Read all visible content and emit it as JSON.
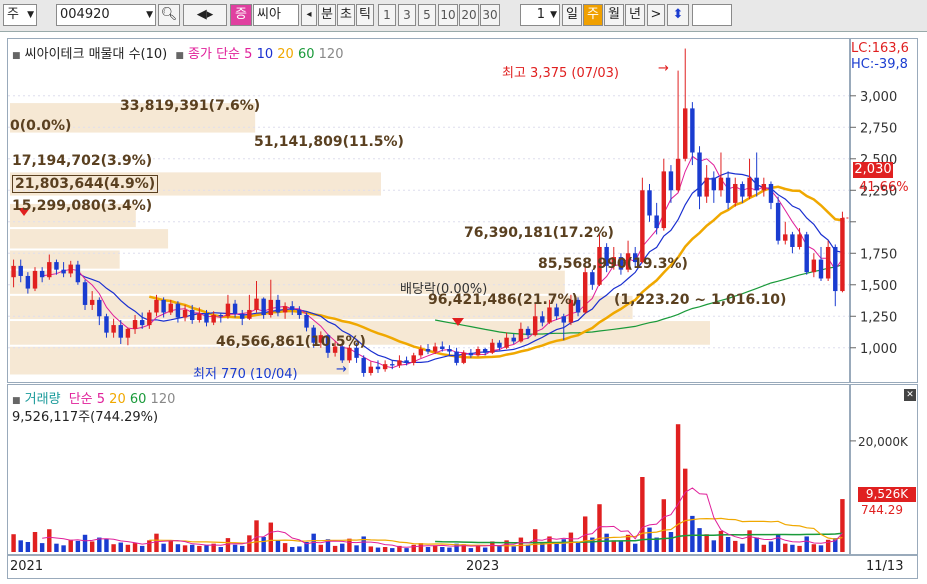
{
  "toolbar": {
    "type_select": "주",
    "code": "004920",
    "name_tag": "증",
    "name": "씨아",
    "arrow_left": "◂",
    "minute": "분",
    "second": "초",
    "tick": "틱",
    "periods": [
      "1",
      "3",
      "5",
      "10",
      "20",
      "30"
    ],
    "count": "1",
    "day": "일",
    "week": "주",
    "month": "월",
    "year": "년",
    "arrow_right": ">",
    "updown": "⬍"
  },
  "price_panel": {
    "stock_title": "씨아이테크 매물대 수(10)",
    "ma_label": "종가 단순",
    "ma_periods": [
      "5",
      "10",
      "20",
      "60",
      "120"
    ],
    "ma_colors": [
      "#e0209a",
      "#1a2fd0",
      "#f0a800",
      "#1a9a3a",
      "#888888"
    ],
    "lc": "LC:163,6",
    "hc": "HC:-39,8",
    "high_label": "최고 3,375 (07/03)",
    "low_label": "최저 770 (10/04)",
    "dividend_label": "배당락(0.00%)",
    "range_label": "(1,223.20 ~ 1,016.10)",
    "current_price": "2,030",
    "current_pct": "41.66%",
    "up_color": "#e02020",
    "down_color": "#1a3cd0"
  },
  "volume_profile": [
    {
      "price_hi": 2950,
      "price_lo": 2700,
      "label": "33,819,391(7.6%)"
    },
    {
      "price_hi": 2600,
      "price_lo": 2450,
      "label": "0(0.0%)"
    },
    {
      "price_hi": 2400,
      "price_lo": 2200,
      "label": "51,141,809(11.5%)"
    },
    {
      "price_hi": 2150,
      "price_lo": 1950,
      "label": "17,194,702(3.9%)"
    },
    {
      "price_hi": 1950,
      "price_lo": 1780,
      "label": "21,803,644(4.9%)"
    },
    {
      "price_hi": 1780,
      "price_lo": 1620,
      "label": "15,299,080(3.4%)"
    },
    {
      "price_hi": 1620,
      "price_lo": 1420,
      "label": "76,390,181(17.2%)"
    },
    {
      "price_hi": 1420,
      "price_lo": 1220,
      "label": "85,568,990(19.3%)"
    },
    {
      "price_hi": 1220,
      "price_lo": 1016,
      "label": "96,421,486(21.7%)"
    },
    {
      "price_hi": 1016,
      "price_lo": 780,
      "label": "46,566,861(10.5%)"
    }
  ],
  "volume_panel": {
    "title": "거래량",
    "ma_label": "단순",
    "ma_periods": [
      "5",
      "20",
      "60",
      "120"
    ],
    "ma_colors": [
      "#e0209a",
      "#f0a800",
      "#1a9a3a",
      "#888888"
    ],
    "current_label": "9,526,117주(744.29%)",
    "current_value": "9,526K",
    "current_pct": "744.29"
  },
  "x_axis": {
    "labels": [
      "2021",
      "2023",
      "11/13"
    ]
  },
  "chart_data": {
    "type": "candlestick",
    "y_axis_price": {
      "ticks": [
        1000,
        1250,
        1500,
        1750,
        2000,
        2250,
        2500,
        2750,
        3000
      ],
      "tick_labels": [
        "1,000",
        "1,250",
        "1,500",
        "1,750",
        "",
        "2,250",
        "2,500",
        "2,750",
        "3,000"
      ],
      "ylim": [
        760,
        3300
      ]
    },
    "y_axis_volume": {
      "ticks": [
        20000
      ],
      "tick_labels": [
        "20,000K"
      ],
      "ylim": [
        0,
        27000
      ]
    },
    "weekly": [
      {
        "o": 1560,
        "c": 1650,
        "h": 1700,
        "l": 1480,
        "v": 3200
      },
      {
        "o": 1650,
        "c": 1570,
        "h": 1700,
        "l": 1520,
        "v": 2100
      },
      {
        "o": 1570,
        "c": 1470,
        "h": 1600,
        "l": 1430,
        "v": 1800
      },
      {
        "o": 1470,
        "c": 1610,
        "h": 1640,
        "l": 1450,
        "v": 3600
      },
      {
        "o": 1610,
        "c": 1560,
        "h": 1640,
        "l": 1520,
        "v": 1600
      },
      {
        "o": 1560,
        "c": 1680,
        "h": 1740,
        "l": 1540,
        "v": 4100
      },
      {
        "o": 1680,
        "c": 1620,
        "h": 1700,
        "l": 1580,
        "v": 1500
      },
      {
        "o": 1620,
        "c": 1590,
        "h": 1680,
        "l": 1560,
        "v": 1200
      },
      {
        "o": 1590,
        "c": 1660,
        "h": 1690,
        "l": 1560,
        "v": 2200
      },
      {
        "o": 1660,
        "c": 1520,
        "h": 1690,
        "l": 1500,
        "v": 2000
      },
      {
        "o": 1520,
        "c": 1340,
        "h": 1540,
        "l": 1300,
        "v": 3100
      },
      {
        "o": 1340,
        "c": 1380,
        "h": 1450,
        "l": 1300,
        "v": 1900
      },
      {
        "o": 1380,
        "c": 1250,
        "h": 1400,
        "l": 1180,
        "v": 2600
      },
      {
        "o": 1250,
        "c": 1120,
        "h": 1270,
        "l": 1080,
        "v": 2400
      },
      {
        "o": 1120,
        "c": 1180,
        "h": 1230,
        "l": 1080,
        "v": 1400
      },
      {
        "o": 1180,
        "c": 1080,
        "h": 1220,
        "l": 1030,
        "v": 1700
      },
      {
        "o": 1080,
        "c": 1150,
        "h": 1160,
        "l": 1020,
        "v": 1300
      },
      {
        "o": 1150,
        "c": 1220,
        "h": 1260,
        "l": 1110,
        "v": 1600
      },
      {
        "o": 1220,
        "c": 1180,
        "h": 1280,
        "l": 1150,
        "v": 1100
      },
      {
        "o": 1180,
        "c": 1280,
        "h": 1300,
        "l": 1150,
        "v": 2100
      },
      {
        "o": 1280,
        "c": 1380,
        "h": 1420,
        "l": 1250,
        "v": 3300
      },
      {
        "o": 1380,
        "c": 1280,
        "h": 1400,
        "l": 1240,
        "v": 1500
      },
      {
        "o": 1280,
        "c": 1350,
        "h": 1380,
        "l": 1260,
        "v": 2000
      },
      {
        "o": 1350,
        "c": 1240,
        "h": 1370,
        "l": 1200,
        "v": 1400
      },
      {
        "o": 1240,
        "c": 1300,
        "h": 1340,
        "l": 1210,
        "v": 1200
      },
      {
        "o": 1300,
        "c": 1220,
        "h": 1340,
        "l": 1190,
        "v": 1300
      },
      {
        "o": 1220,
        "c": 1270,
        "h": 1320,
        "l": 1200,
        "v": 1100
      },
      {
        "o": 1270,
        "c": 1200,
        "h": 1300,
        "l": 1170,
        "v": 1200
      },
      {
        "o": 1200,
        "c": 1260,
        "h": 1290,
        "l": 1180,
        "v": 1500
      },
      {
        "o": 1260,
        "c": 1250,
        "h": 1280,
        "l": 1200,
        "v": 900
      },
      {
        "o": 1250,
        "c": 1350,
        "h": 1420,
        "l": 1230,
        "v": 2500
      },
      {
        "o": 1350,
        "c": 1270,
        "h": 1380,
        "l": 1240,
        "v": 1300
      },
      {
        "o": 1270,
        "c": 1230,
        "h": 1300,
        "l": 1180,
        "v": 1100
      },
      {
        "o": 1230,
        "c": 1300,
        "h": 1420,
        "l": 1220,
        "v": 3000
      },
      {
        "o": 1300,
        "c": 1390,
        "h": 1530,
        "l": 1280,
        "v": 5700
      },
      {
        "o": 1390,
        "c": 1260,
        "h": 1400,
        "l": 1230,
        "v": 2700
      },
      {
        "o": 1260,
        "c": 1380,
        "h": 1540,
        "l": 1240,
        "v": 5300
      },
      {
        "o": 1380,
        "c": 1280,
        "h": 1420,
        "l": 1250,
        "v": 2100
      },
      {
        "o": 1280,
        "c": 1330,
        "h": 1360,
        "l": 1230,
        "v": 1600
      },
      {
        "o": 1330,
        "c": 1300,
        "h": 1370,
        "l": 1260,
        "v": 900
      },
      {
        "o": 1300,
        "c": 1260,
        "h": 1330,
        "l": 1230,
        "v": 1000
      },
      {
        "o": 1260,
        "c": 1160,
        "h": 1280,
        "l": 1130,
        "v": 1800
      },
      {
        "o": 1160,
        "c": 1040,
        "h": 1180,
        "l": 1000,
        "v": 3300
      },
      {
        "o": 1040,
        "c": 1100,
        "h": 1130,
        "l": 1000,
        "v": 1300
      },
      {
        "o": 1100,
        "c": 960,
        "h": 1110,
        "l": 920,
        "v": 2300
      },
      {
        "o": 960,
        "c": 1010,
        "h": 1050,
        "l": 930,
        "v": 1100
      },
      {
        "o": 1010,
        "c": 900,
        "h": 1020,
        "l": 880,
        "v": 1500
      },
      {
        "o": 900,
        "c": 1000,
        "h": 1020,
        "l": 880,
        "v": 2400
      },
      {
        "o": 1000,
        "c": 920,
        "h": 1040,
        "l": 880,
        "v": 1200
      },
      {
        "o": 920,
        "c": 800,
        "h": 940,
        "l": 770,
        "v": 2800
      },
      {
        "o": 800,
        "c": 850,
        "h": 890,
        "l": 780,
        "v": 1000
      },
      {
        "o": 850,
        "c": 830,
        "h": 900,
        "l": 800,
        "v": 800
      },
      {
        "o": 830,
        "c": 870,
        "h": 900,
        "l": 810,
        "v": 900
      },
      {
        "o": 870,
        "c": 860,
        "h": 900,
        "l": 830,
        "v": 700
      },
      {
        "o": 860,
        "c": 900,
        "h": 940,
        "l": 840,
        "v": 1100
      },
      {
        "o": 900,
        "c": 880,
        "h": 930,
        "l": 860,
        "v": 700
      },
      {
        "o": 880,
        "c": 940,
        "h": 960,
        "l": 860,
        "v": 1300
      },
      {
        "o": 940,
        "c": 990,
        "h": 1020,
        "l": 920,
        "v": 1600
      },
      {
        "o": 990,
        "c": 970,
        "h": 1030,
        "l": 950,
        "v": 900
      },
      {
        "o": 970,
        "c": 1010,
        "h": 1040,
        "l": 950,
        "v": 1200
      },
      {
        "o": 1010,
        "c": 990,
        "h": 1050,
        "l": 970,
        "v": 900
      },
      {
        "o": 990,
        "c": 970,
        "h": 1020,
        "l": 940,
        "v": 800
      },
      {
        "o": 970,
        "c": 880,
        "h": 1000,
        "l": 860,
        "v": 1500
      },
      {
        "o": 880,
        "c": 960,
        "h": 980,
        "l": 870,
        "v": 1400
      },
      {
        "o": 960,
        "c": 940,
        "h": 990,
        "l": 920,
        "v": 700
      },
      {
        "o": 940,
        "c": 990,
        "h": 1010,
        "l": 930,
        "v": 1100
      },
      {
        "o": 990,
        "c": 960,
        "h": 1000,
        "l": 940,
        "v": 800
      },
      {
        "o": 960,
        "c": 1040,
        "h": 1070,
        "l": 950,
        "v": 1900
      },
      {
        "o": 1040,
        "c": 1000,
        "h": 1060,
        "l": 980,
        "v": 1100
      },
      {
        "o": 1000,
        "c": 1080,
        "h": 1120,
        "l": 990,
        "v": 2100
      },
      {
        "o": 1080,
        "c": 1050,
        "h": 1110,
        "l": 1030,
        "v": 1000
      },
      {
        "o": 1050,
        "c": 1150,
        "h": 1200,
        "l": 1040,
        "v": 2600
      },
      {
        "o": 1150,
        "c": 1100,
        "h": 1170,
        "l": 1070,
        "v": 1300
      },
      {
        "o": 1100,
        "c": 1250,
        "h": 1350,
        "l": 1090,
        "v": 4100
      },
      {
        "o": 1250,
        "c": 1200,
        "h": 1290,
        "l": 1170,
        "v": 1600
      },
      {
        "o": 1200,
        "c": 1320,
        "h": 1380,
        "l": 1190,
        "v": 2800
      },
      {
        "o": 1320,
        "c": 1250,
        "h": 1350,
        "l": 1220,
        "v": 1600
      },
      {
        "o": 1250,
        "c": 1200,
        "h": 1270,
        "l": 1060,
        "v": 2300
      },
      {
        "o": 1200,
        "c": 1380,
        "h": 1420,
        "l": 1180,
        "v": 3500
      },
      {
        "o": 1380,
        "c": 1280,
        "h": 1400,
        "l": 1250,
        "v": 1800
      },
      {
        "o": 1280,
        "c": 1600,
        "h": 1650,
        "l": 1270,
        "v": 6400
      },
      {
        "o": 1600,
        "c": 1500,
        "h": 1620,
        "l": 1460,
        "v": 2600
      },
      {
        "o": 1500,
        "c": 1800,
        "h": 1900,
        "l": 1490,
        "v": 8600
      },
      {
        "o": 1800,
        "c": 1650,
        "h": 1830,
        "l": 1600,
        "v": 3300
      },
      {
        "o": 1650,
        "c": 1720,
        "h": 1800,
        "l": 1620,
        "v": 2100
      },
      {
        "o": 1720,
        "c": 1620,
        "h": 1750,
        "l": 1580,
        "v": 1900
      },
      {
        "o": 1620,
        "c": 1750,
        "h": 1850,
        "l": 1600,
        "v": 3100
      },
      {
        "o": 1750,
        "c": 1680,
        "h": 1800,
        "l": 1640,
        "v": 1500
      },
      {
        "o": 1680,
        "c": 2250,
        "h": 2350,
        "l": 1670,
        "v": 13500
      },
      {
        "o": 2250,
        "c": 2050,
        "h": 2300,
        "l": 2000,
        "v": 4400
      },
      {
        "o": 2050,
        "c": 1950,
        "h": 2150,
        "l": 1900,
        "v": 2600
      },
      {
        "o": 1950,
        "c": 2400,
        "h": 2500,
        "l": 1930,
        "v": 9500
      },
      {
        "o": 2400,
        "c": 2250,
        "h": 2450,
        "l": 2150,
        "v": 3600
      },
      {
        "o": 2250,
        "c": 2500,
        "h": 3200,
        "l": 2240,
        "v": 23000
      },
      {
        "o": 2500,
        "c": 2900,
        "h": 3375,
        "l": 2480,
        "v": 15000
      },
      {
        "o": 2900,
        "c": 2550,
        "h": 2950,
        "l": 2450,
        "v": 6500
      },
      {
        "o": 2550,
        "c": 2200,
        "h": 2600,
        "l": 2100,
        "v": 4300
      },
      {
        "o": 2200,
        "c": 2350,
        "h": 2450,
        "l": 2150,
        "v": 3200
      },
      {
        "o": 2350,
        "c": 2250,
        "h": 2400,
        "l": 2150,
        "v": 2100
      },
      {
        "o": 2250,
        "c": 2350,
        "h": 2550,
        "l": 2200,
        "v": 3800
      },
      {
        "o": 2350,
        "c": 2150,
        "h": 2400,
        "l": 2100,
        "v": 2700
      },
      {
        "o": 2150,
        "c": 2300,
        "h": 2350,
        "l": 2120,
        "v": 2000
      },
      {
        "o": 2300,
        "c": 2200,
        "h": 2320,
        "l": 2150,
        "v": 1500
      },
      {
        "o": 2200,
        "c": 2350,
        "h": 2500,
        "l": 2180,
        "v": 3900
      },
      {
        "o": 2350,
        "c": 2250,
        "h": 2550,
        "l": 2200,
        "v": 2600
      },
      {
        "o": 2250,
        "c": 2300,
        "h": 2350,
        "l": 2200,
        "v": 1300
      },
      {
        "o": 2300,
        "c": 2150,
        "h": 2320,
        "l": 2100,
        "v": 1900
      },
      {
        "o": 2150,
        "c": 1850,
        "h": 2200,
        "l": 1820,
        "v": 3200
      },
      {
        "o": 1850,
        "c": 1900,
        "h": 2000,
        "l": 1820,
        "v": 1500
      },
      {
        "o": 1900,
        "c": 1800,
        "h": 1920,
        "l": 1750,
        "v": 1300
      },
      {
        "o": 1800,
        "c": 1900,
        "h": 1950,
        "l": 1780,
        "v": 1100
      },
      {
        "o": 1900,
        "c": 1600,
        "h": 1920,
        "l": 1580,
        "v": 2800
      },
      {
        "o": 1600,
        "c": 1700,
        "h": 1750,
        "l": 1560,
        "v": 1400
      },
      {
        "o": 1700,
        "c": 1550,
        "h": 1800,
        "l": 1530,
        "v": 1200
      },
      {
        "o": 1550,
        "c": 1800,
        "h": 1850,
        "l": 1530,
        "v": 2200
      },
      {
        "o": 1800,
        "c": 1450,
        "h": 1820,
        "l": 1330,
        "v": 2500
      },
      {
        "o": 1450,
        "c": 2030,
        "h": 2080,
        "l": 1440,
        "v": 9526
      }
    ]
  }
}
